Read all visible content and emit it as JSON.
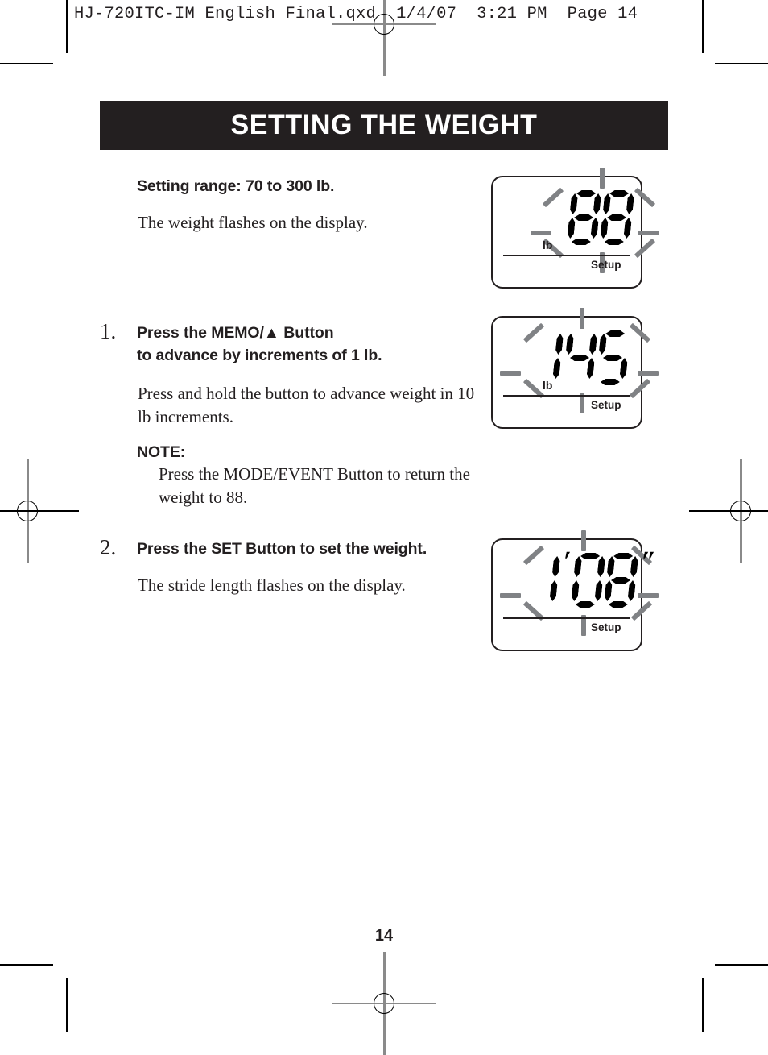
{
  "print_marks": {
    "slug_text": "HJ-720ITC-IM English Final.qxd  1/4/07  3:21 PM  Page 14"
  },
  "header": {
    "title": "SETTING THE WEIGHT"
  },
  "intro": {
    "heading": "Setting range: 70 to 300 lb.",
    "body": "The weight flashes on the display."
  },
  "steps": [
    {
      "number": "1.",
      "heading_line1": "Press the MEMO/▲ Button",
      "heading_line2": "to advance by increments of 1 lb.",
      "body": "Press and hold the button to advance weight in 10 lb increments.",
      "note_label": "NOTE:",
      "note_body": "Press the MODE/EVENT Button to return the weight to 88."
    },
    {
      "number": "2.",
      "heading_line1": "Press the SET Button to set the weight.",
      "body": "The stride length flashes on the display."
    }
  ],
  "displays": [
    {
      "id": "weight-default",
      "value": "88",
      "unit_label": "lb",
      "mode_label": "Setup",
      "flashing": true
    },
    {
      "id": "weight-adjusted",
      "value": "145",
      "unit_label": "lb",
      "mode_label": "Setup",
      "flashing": true
    },
    {
      "id": "stride-length",
      "value": "1'08\"",
      "unit_label": "",
      "mode_label": "Setup",
      "flashing": true
    }
  ],
  "footer": {
    "page_number": "14"
  },
  "colors": {
    "ink": "#231f20",
    "banner_bg": "#231f20",
    "banner_text": "#ffffff",
    "flash_ray": "#808285"
  }
}
